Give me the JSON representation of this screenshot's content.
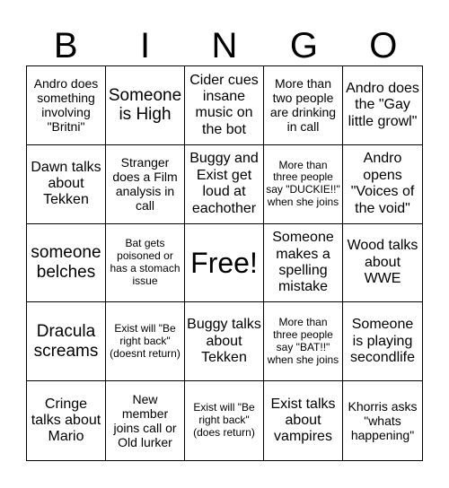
{
  "header": {
    "letters": [
      "B",
      "I",
      "N",
      "G",
      "O"
    ]
  },
  "board": {
    "cells": [
      "Andro does something involving \"Britni\"",
      "Someone is High",
      "Cider cues insane music on the bot",
      "More than two people are drinking in call",
      "Andro does the \"Gay little growl\"",
      "Dawn talks about Tekken",
      "Stranger does a Film analysis in call",
      "Buggy and Exist get loud at eachother",
      "More than three people say \"DUCKIE!!\" when she joins",
      "Andro opens \"Voices of the void\"",
      "someone belches",
      "Bat gets poisoned or has a stomach issue",
      "Free!",
      "Someone makes a spelling mistake",
      "Wood talks about WWE",
      "Dracula screams",
      "Exist will \"Be right back\" (doesnt return)",
      "Buggy talks about Tekken",
      "More than three people say \"BAT!!\" when she joins",
      "Someone is playing secondlife",
      "Cringe talks about Mario",
      "New member joins call or Old lurker",
      "Exist will \"Be right back\" (does return)",
      "Exist talks about vampires",
      "Khorris asks \"whats happening\""
    ]
  }
}
